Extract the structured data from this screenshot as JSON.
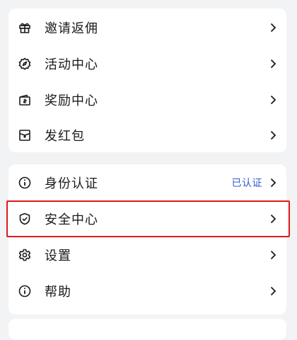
{
  "menu_group_1": {
    "items": [
      {
        "label": "邀请返佣",
        "icon": "gift-icon"
      },
      {
        "label": "活动中心",
        "icon": "compass-icon"
      },
      {
        "label": "奖励中心",
        "icon": "wallet-icon"
      },
      {
        "label": "发红包",
        "icon": "red-envelope-icon"
      }
    ]
  },
  "menu_group_2": {
    "items": [
      {
        "label": "身份认证",
        "icon": "info-icon",
        "status": "已认证"
      },
      {
        "label": "安全中心",
        "icon": "shield-icon"
      },
      {
        "label": "设置",
        "icon": "gear-icon"
      },
      {
        "label": "帮助",
        "icon": "help-icon"
      }
    ]
  },
  "colors": {
    "background": "#f2f3f5",
    "card": "#ffffff",
    "text": "#1a1a1a",
    "status_link": "#2f5bd3",
    "highlight": "#e01b1b"
  }
}
